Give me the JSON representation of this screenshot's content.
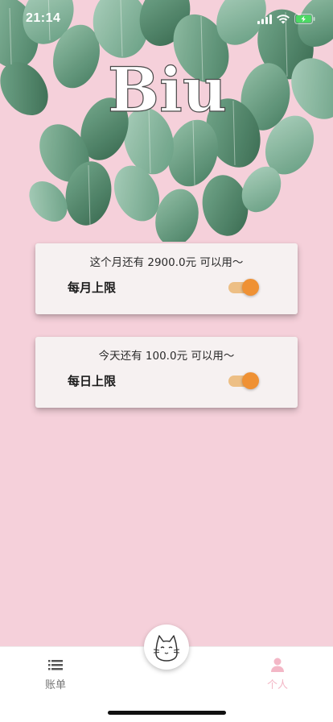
{
  "status_bar": {
    "time": "21:14"
  },
  "logo": {
    "text": "Biu"
  },
  "budget_cards": [
    {
      "message": "这个月还有 2900.0元 可以用～",
      "label": "每月上限",
      "enabled": true
    },
    {
      "message": "今天还有 100.0元 可以用～",
      "label": "每日上限",
      "enabled": true
    }
  ],
  "tab_bar": {
    "tabs": [
      {
        "label": "账单",
        "icon": "list-icon",
        "active": false
      },
      {
        "label": "个人",
        "icon": "person-icon",
        "active": true
      }
    ],
    "center_icon": "cat-face-icon"
  },
  "colors": {
    "background": "#f5d0da",
    "card": "#f6f1f1",
    "toggle_thumb": "#ef9134",
    "toggle_track": "#edbf85",
    "active_tab": "#f3b7c6"
  }
}
